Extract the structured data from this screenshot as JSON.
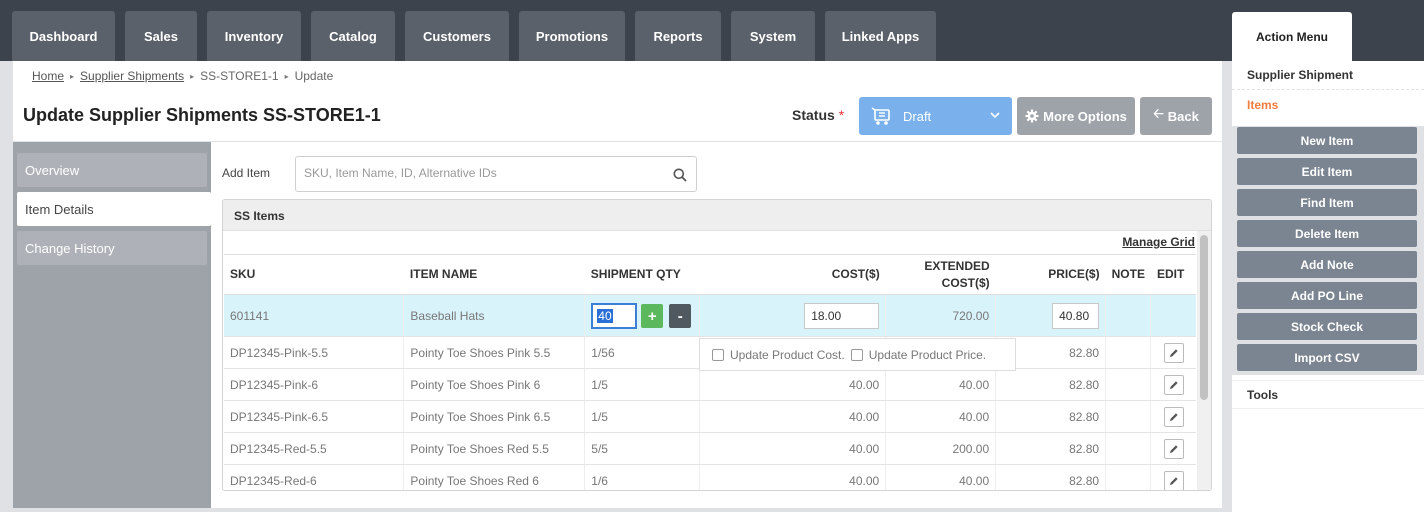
{
  "nav": {
    "tabs": [
      {
        "label": "Dashboard"
      },
      {
        "label": "Sales"
      },
      {
        "label": "Inventory"
      },
      {
        "label": "Catalog"
      },
      {
        "label": "Customers"
      },
      {
        "label": "Promotions"
      },
      {
        "label": "Reports"
      },
      {
        "label": "System"
      },
      {
        "label": "Linked Apps"
      }
    ]
  },
  "breadcrumb": {
    "home": "Home",
    "supplier_shipments": "Supplier Shipments",
    "record": "SS-STORE1-1",
    "current": "Update"
  },
  "header": {
    "title": "Update Supplier Shipments SS-STORE1-1",
    "status_label": "Status",
    "required_mark": "*",
    "status_value": "Draft",
    "more_options": "More Options",
    "back": "Back"
  },
  "sidenav": {
    "items": [
      {
        "label": "Overview"
      },
      {
        "label": "Item Details"
      },
      {
        "label": "Change History"
      }
    ]
  },
  "add_item": {
    "label": "Add Item",
    "placeholder": "SKU, Item Name, ID, Alternative IDs"
  },
  "grid": {
    "title": "SS Items",
    "manage_grid": "Manage Grid",
    "columns": {
      "sku": "SKU",
      "item_name": "ITEM NAME",
      "shipment_qty": "SHIPMENT QTY",
      "cost": "COST($)",
      "extended_cost": "EXTENDED COST($)",
      "price": "PRICE($)",
      "note": "NOTE",
      "edit": "EDIT"
    },
    "selected_row": {
      "sku": "601141",
      "item_name": "Baseball Hats",
      "qty": "40",
      "cost": "18.00",
      "extended_cost": "720.00",
      "price": "40.80"
    },
    "rows": [
      {
        "sku": "DP12345-Pink-5.5",
        "item_name": "Pointy Toe Shoes Pink 5.5",
        "qty": "1/56",
        "cost": "",
        "extended_cost": "",
        "price": "82.80"
      },
      {
        "sku": "DP12345-Pink-6",
        "item_name": "Pointy Toe Shoes Pink 6",
        "qty": "1/5",
        "cost": "40.00",
        "extended_cost": "40.00",
        "price": "82.80"
      },
      {
        "sku": "DP12345-Pink-6.5",
        "item_name": "Pointy Toe Shoes Pink 6.5",
        "qty": "1/5",
        "cost": "40.00",
        "extended_cost": "40.00",
        "price": "82.80"
      },
      {
        "sku": "DP12345-Red-5.5",
        "item_name": "Pointy Toe Shoes Red 5.5",
        "qty": "5/5",
        "cost": "40.00",
        "extended_cost": "200.00",
        "price": "82.80"
      },
      {
        "sku": "DP12345-Red-6",
        "item_name": "Pointy Toe Shoes Red 6",
        "qty": "1/6",
        "cost": "40.00",
        "extended_cost": "40.00",
        "price": "82.80"
      }
    ],
    "popover": {
      "update_cost": "Update Product Cost.",
      "update_price": "Update Product Price."
    }
  },
  "action_menu": {
    "tab": "Action Menu",
    "section": "Supplier Shipment",
    "subsection": "Items",
    "buttons": [
      {
        "label": "New Item"
      },
      {
        "label": "Edit Item"
      },
      {
        "label": "Find Item"
      },
      {
        "label": "Delete Item"
      },
      {
        "label": "Add Note"
      },
      {
        "label": "Add PO Line"
      },
      {
        "label": "Stock Check"
      },
      {
        "label": "Import CSV"
      }
    ],
    "tools": "Tools"
  },
  "colors": {
    "nav_bg": "#3d434c",
    "tab_bg": "#5a616b",
    "status_blue": "#7ab1ed",
    "accent_orange": "#f07c3f",
    "selected_row": "#d9f3fb",
    "plus_green": "#5cb85c"
  }
}
